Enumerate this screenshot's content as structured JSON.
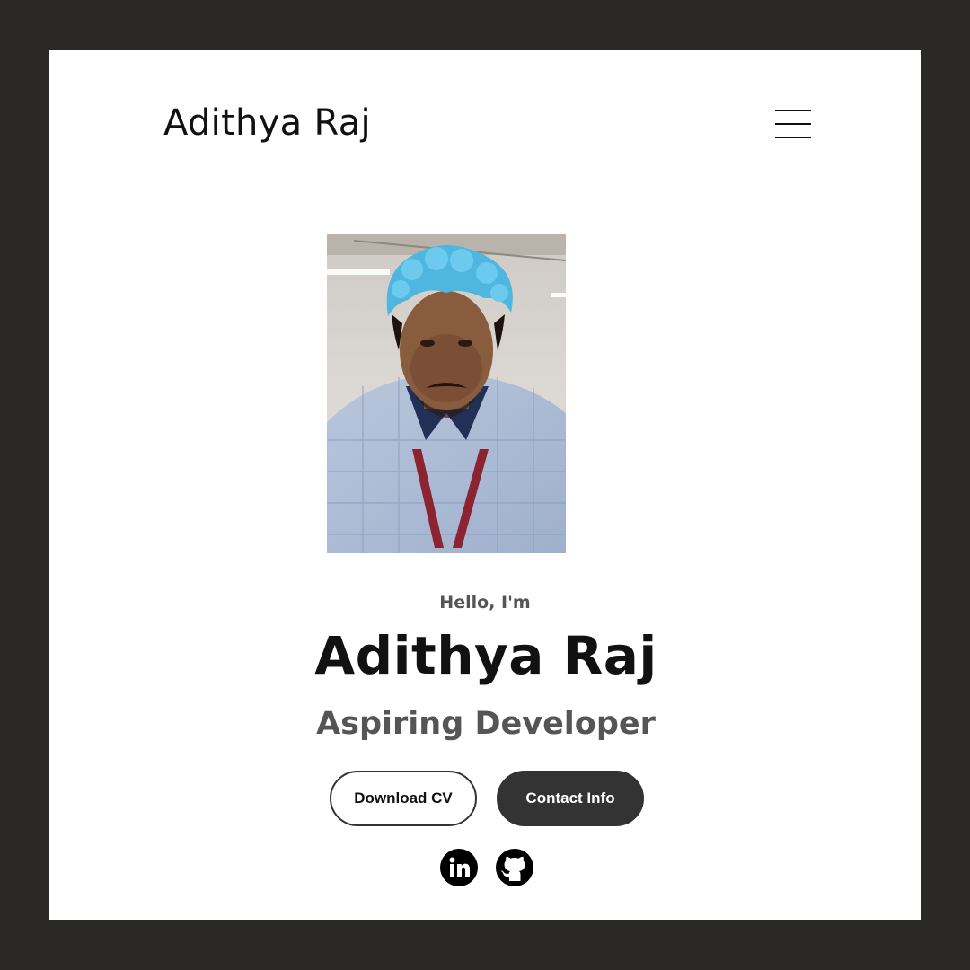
{
  "header": {
    "brand": "Adithya Raj",
    "menu_icon": "hamburger-menu-icon"
  },
  "hero": {
    "photo_alt": "Profile picture",
    "greeting": "Hello, I'm",
    "name": "Adithya Raj",
    "role": "Aspiring Developer",
    "buttons": {
      "download_cv": "Download CV",
      "contact_info": "Contact Info"
    },
    "social": [
      {
        "icon": "linkedin-icon"
      },
      {
        "icon": "github-icon"
      }
    ]
  },
  "colors": {
    "outer_frame": "#2b2828",
    "page_background": "#ffffff",
    "primary_text": "#111111",
    "secondary_text": "#555555",
    "dark_button": "#333333"
  }
}
